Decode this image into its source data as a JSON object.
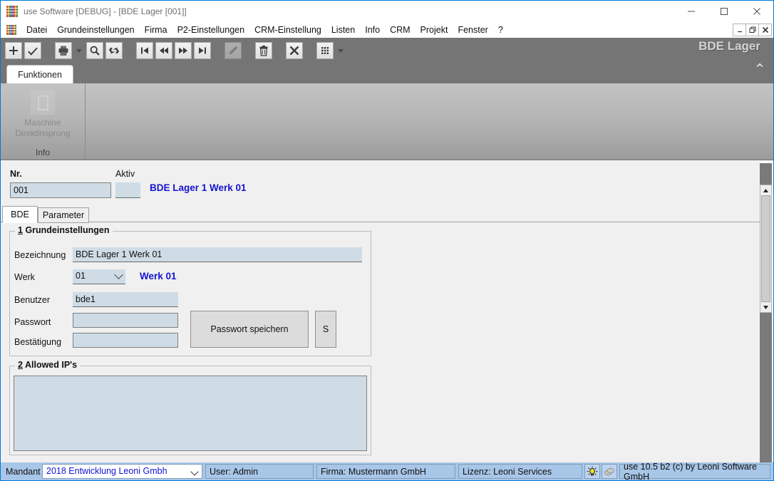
{
  "window": {
    "title": "use Software [DEBUG] - [BDE Lager [001]]",
    "app_icon": "grid-color-icon",
    "controls": {
      "minimize": "minimize-icon",
      "maximize": "maximize-icon",
      "close": "close-icon"
    },
    "mdi_controls": {
      "restore_down": "_",
      "restore": "❐",
      "close": "✕"
    }
  },
  "menu": {
    "icon": "grid-color-icon",
    "items": [
      "Datei",
      "Grundeinstellungen",
      "Firma",
      "P2-Einstellungen",
      "CRM-Einstellung",
      "Listen",
      "Info",
      "CRM",
      "Projekt",
      "Fenster",
      "?"
    ]
  },
  "toolbar": {
    "buttons": [
      {
        "name": "new-record-button",
        "icon": "plus-icon",
        "disabled": false
      },
      {
        "name": "confirm-button",
        "icon": "check-icon",
        "disabled": false
      },
      {
        "name": "print-button",
        "icon": "printer-icon",
        "disabled": false
      },
      {
        "name": "print-dropdown",
        "icon": "caret-down-icon",
        "disabled": false
      },
      {
        "name": "search-button",
        "icon": "magnifier-icon",
        "disabled": false
      },
      {
        "name": "refresh-button",
        "icon": "refresh-icon",
        "disabled": false
      },
      {
        "name": "first-record-button",
        "icon": "nav-first-icon",
        "disabled": false
      },
      {
        "name": "previous-record-button",
        "icon": "nav-prev-icon",
        "disabled": false
      },
      {
        "name": "next-record-button",
        "icon": "nav-next-icon",
        "disabled": false
      },
      {
        "name": "last-record-button",
        "icon": "nav-last-icon",
        "disabled": false
      },
      {
        "name": "edit-button",
        "icon": "pencil-icon",
        "disabled": true
      },
      {
        "name": "delete-button",
        "icon": "trash-icon",
        "disabled": false
      },
      {
        "name": "cancel-button",
        "icon": "cross-icon",
        "disabled": false
      },
      {
        "name": "grid-view-button",
        "icon": "grid-icon",
        "disabled": false
      },
      {
        "name": "grid-dropdown",
        "icon": "caret-down-icon",
        "disabled": false
      }
    ],
    "window_label": "BDE Lager"
  },
  "ribbon": {
    "tab_label": "Funktionen",
    "group": {
      "button_line1": "Maschine",
      "button_line2": "Direktinsprung",
      "button_icon": "rectangle-outline-icon",
      "footer": "Info"
    },
    "collapse_icon": "chevron-up-icon"
  },
  "header": {
    "nr_label": "Nr.",
    "nr_value": "001",
    "aktiv_label": "Aktiv",
    "aktiv_value": "",
    "record_title": "BDE Lager 1 Werk 01"
  },
  "tabs": [
    {
      "label": "BDE",
      "active": true
    },
    {
      "label": "Parameter",
      "active": false
    }
  ],
  "groupbox1": {
    "number": "1",
    "title": "Grundeinstellungen",
    "fields": {
      "bezeichnung_label": "Bezeichnung",
      "bezeichnung_value": "BDE Lager 1 Werk 01",
      "werk_label": "Werk",
      "werk_value": "01",
      "werk_text": "Werk 01",
      "benutzer_label": "Benutzer",
      "benutzer_value": "bde1",
      "passwort_label": "Passwort",
      "passwort_value": "",
      "bestaetigung_label": "Bestätigung",
      "bestaetigung_value": ""
    },
    "save_password_button": "Passwort speichern",
    "s_button": "S"
  },
  "groupbox2": {
    "number": "2",
    "title": "Allowed IP's",
    "value": ""
  },
  "statusbar": {
    "mandant_label": "Mandant",
    "mandant_value": "2018  Entwicklung Leoni Gmbh",
    "user": "User: Admin",
    "firma": "Firma: Mustermann GmbH",
    "lizenz": "Lizenz: Leoni Services",
    "icon_bulb": "lightbulb-icon",
    "icon_stack": "coins-icon",
    "version": "use 10.5 b2 (c) by Leoni Software GmbH"
  },
  "colors": {
    "accent_blue": "#1414d2",
    "field_blue": "#cfdce6",
    "toolbar_gray": "#757575",
    "status_blue": "#a8c6e8"
  }
}
